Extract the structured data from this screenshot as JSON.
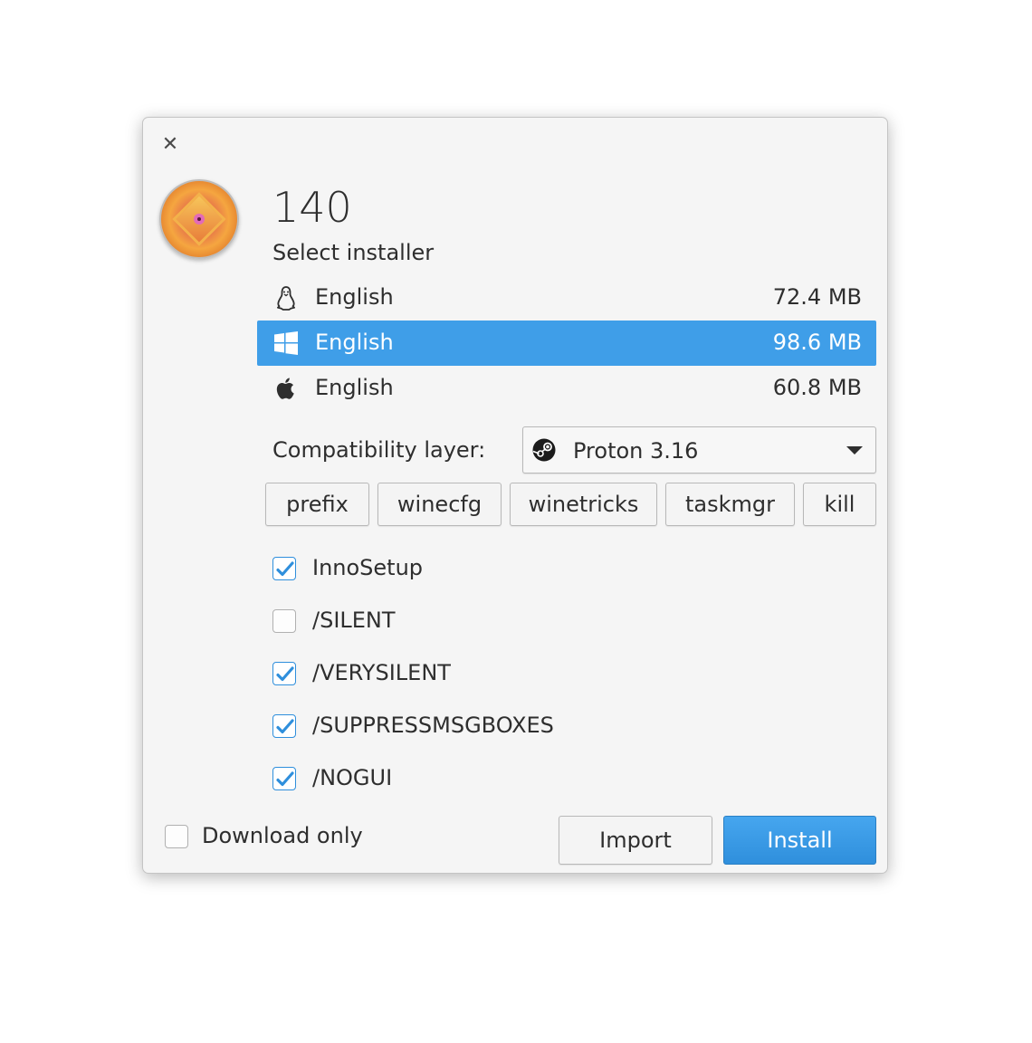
{
  "dialog": {
    "close_icon": "close-icon",
    "game_title": "140",
    "section_label": "Select installer"
  },
  "installers": [
    {
      "os": "linux",
      "icon": "tux-icon",
      "language": "English",
      "size": "72.4 MB",
      "selected": false
    },
    {
      "os": "windows",
      "icon": "windows-icon",
      "language": "English",
      "size": "98.6 MB",
      "selected": true
    },
    {
      "os": "mac",
      "icon": "apple-icon",
      "language": "English",
      "size": "60.8 MB",
      "selected": false
    }
  ],
  "compat": {
    "label": "Compatibility layer:",
    "selected": "Proton 3.16",
    "icon": "steam-icon"
  },
  "tools": {
    "prefix": "prefix",
    "winecfg": "winecfg",
    "winetricks": "winetricks",
    "taskmgr": "taskmgr",
    "kill": "kill"
  },
  "options": [
    {
      "label": "InnoSetup",
      "checked": true
    },
    {
      "label": "/SILENT",
      "checked": false
    },
    {
      "label": "/VERYSILENT",
      "checked": true
    },
    {
      "label": "/SUPPRESSMSGBOXES",
      "checked": true
    },
    {
      "label": "/NOGUI",
      "checked": true
    }
  ],
  "footer": {
    "download_only_label": "Download only",
    "download_only_checked": false,
    "import_label": "Import",
    "install_label": "Install"
  },
  "colors": {
    "accent": "#3f9ee8",
    "check": "#2f8fdc",
    "background": "#f5f5f5"
  }
}
